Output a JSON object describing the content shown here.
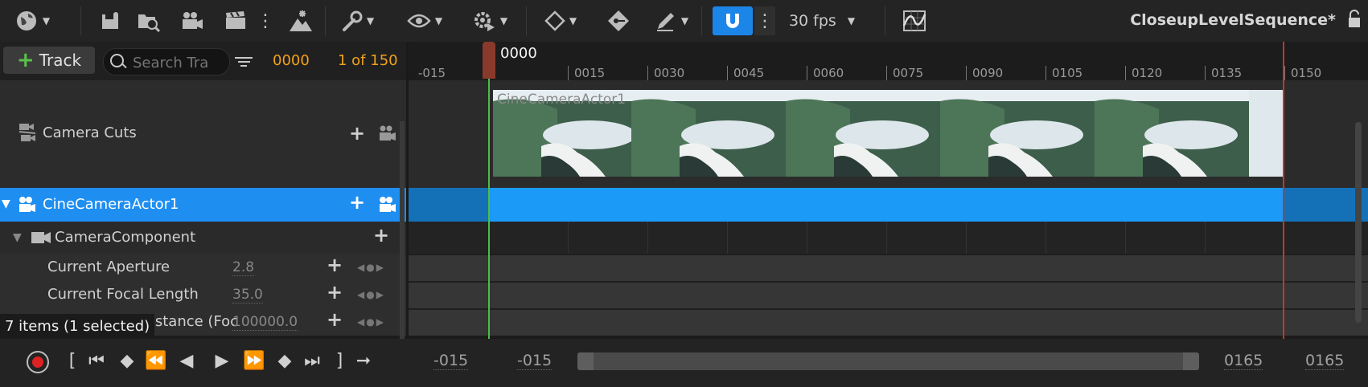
{
  "toolbar": {
    "fps_label": "30 fps",
    "sequence_title": "CloseupLevelSequence*"
  },
  "outliner": {
    "add_track_label": "Track",
    "search_placeholder": "Search Tra",
    "current_time": "0000",
    "frame_counter": "1 of 150",
    "rows": {
      "camera_cuts": "Camera Cuts",
      "cine_camera": "CineCameraActor1",
      "camera_component": "CameraComponent",
      "aperture_label": "Current Aperture",
      "aperture_value": "2.8",
      "focal_label": "Current Focal Length",
      "focal_value": "35.0",
      "focus_label": "Distance (Foc",
      "focus_value": "100000.0"
    },
    "status": "7 items (1 selected)"
  },
  "timeline": {
    "playhead_label": "0000",
    "ticks": [
      "-015",
      "0015",
      "0030",
      "0045",
      "0060",
      "0075",
      "0090",
      "0105",
      "0120",
      "0135",
      "0150"
    ],
    "camera_section_label": "CineCameraActor1"
  },
  "transport": {
    "view_start": "-015",
    "working_start": "-015",
    "working_end": "0165",
    "view_end": "0165"
  },
  "colors": {
    "accent": "#1b9af7",
    "time_orange": "#f0a21c",
    "playhead_green": "#4bbd4b",
    "end_red": "#c0392b"
  }
}
